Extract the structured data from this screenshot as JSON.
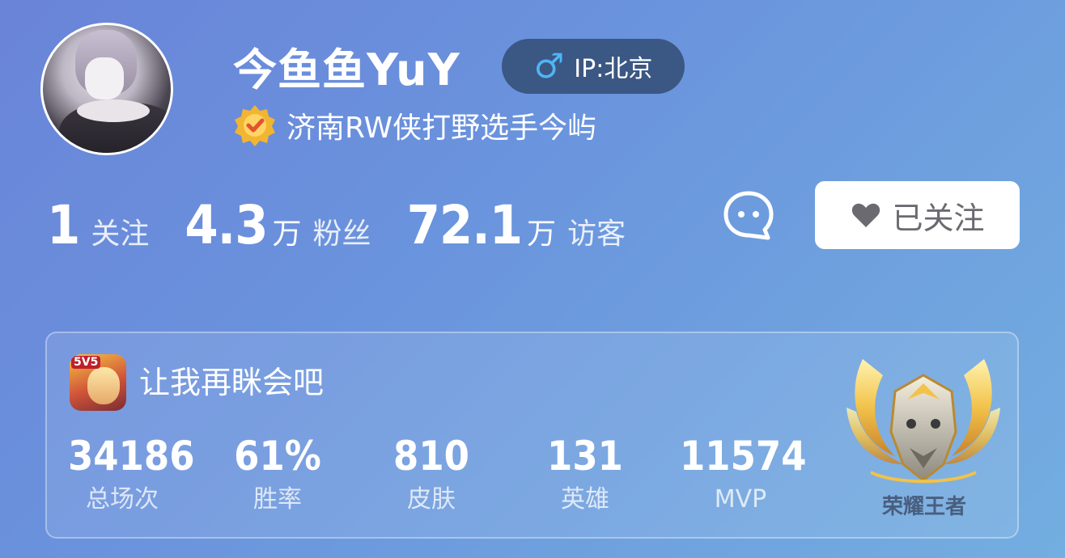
{
  "profile": {
    "name": "今鱼鱼YuY",
    "ip": "IP:北京",
    "gender_icon": "male-icon",
    "gender_symbol": "♂",
    "verify_text": "济南RW侠打野选手今屿"
  },
  "stats": [
    {
      "num": "1",
      "unit": "",
      "label": "关注"
    },
    {
      "num": "4.3",
      "unit": "万",
      "label": "粉丝"
    },
    {
      "num": "72.1",
      "unit": "万",
      "label": "访客"
    }
  ],
  "actions": {
    "follow_label": "已关注"
  },
  "game_card": {
    "title": "让我再眯会吧",
    "stats": [
      {
        "value": "34186",
        "label": "总场次"
      },
      {
        "value": "61%",
        "label": "胜率"
      },
      {
        "value": "810",
        "label": "皮肤"
      },
      {
        "value": "131",
        "label": "英雄"
      },
      {
        "value": "11574",
        "label": "MVP"
      }
    ],
    "rank_text": "荣耀王者"
  },
  "colors": {
    "ip_badge_bg": "#3b5783",
    "gender_blue": "#4fb4f5",
    "verify_gold": "#f2b531"
  }
}
